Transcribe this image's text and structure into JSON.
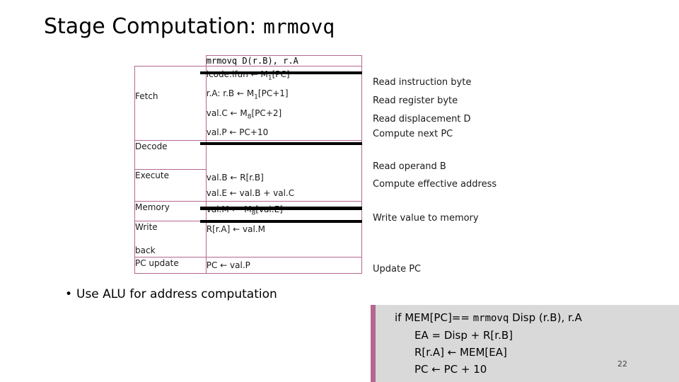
{
  "slide": {
    "title_prefix": "Stage Computation: ",
    "title_mono": "mrmovq",
    "page_number": "22"
  },
  "table": {
    "header": "mrmovq D(r.B), r.A",
    "rows": [
      {
        "stage": "Fetch",
        "ops": [
          "icode:ifun ← M1[PC]",
          "r.A: r.B ← M1[PC+1]",
          "val.C ← M8[PC+2]",
          "val.P ← PC+10"
        ]
      },
      {
        "stage": "Decode",
        "ops": []
      },
      {
        "stage": "Execute",
        "ops": [
          "val.B ← R[r.B]",
          "val.E ← val.B + val.C"
        ]
      },
      {
        "stage": "Memory",
        "ops": [
          "val.M ←  M8[val.E]"
        ]
      },
      {
        "stage": "Write back",
        "ops": [
          "R[r.A] ← val.M"
        ]
      },
      {
        "stage": "PC update",
        "ops": [
          "PC ← val.P"
        ]
      }
    ]
  },
  "comments": [
    "Read instruction byte",
    "Read register byte",
    "Read displacement D",
    "Compute next PC",
    "Read operand B",
    "Compute effective address",
    "Write value to memory",
    "Update PC"
  ],
  "bullet": {
    "marker": "•",
    "text": "Use ALU for address computation"
  },
  "code": {
    "line1_pre": "if MEM[PC]== ",
    "line1_mono": "mrmovq",
    "line1_post": " Disp (r.B), r.A",
    "line2": "EA = Disp + R[r.B]",
    "line3": "R[r.A] ← MEM[EA]",
    "line4": "PC ← PC + 10"
  },
  "colors": {
    "accent": "#b5678f",
    "codebox_bg": "#d9d9d9"
  }
}
